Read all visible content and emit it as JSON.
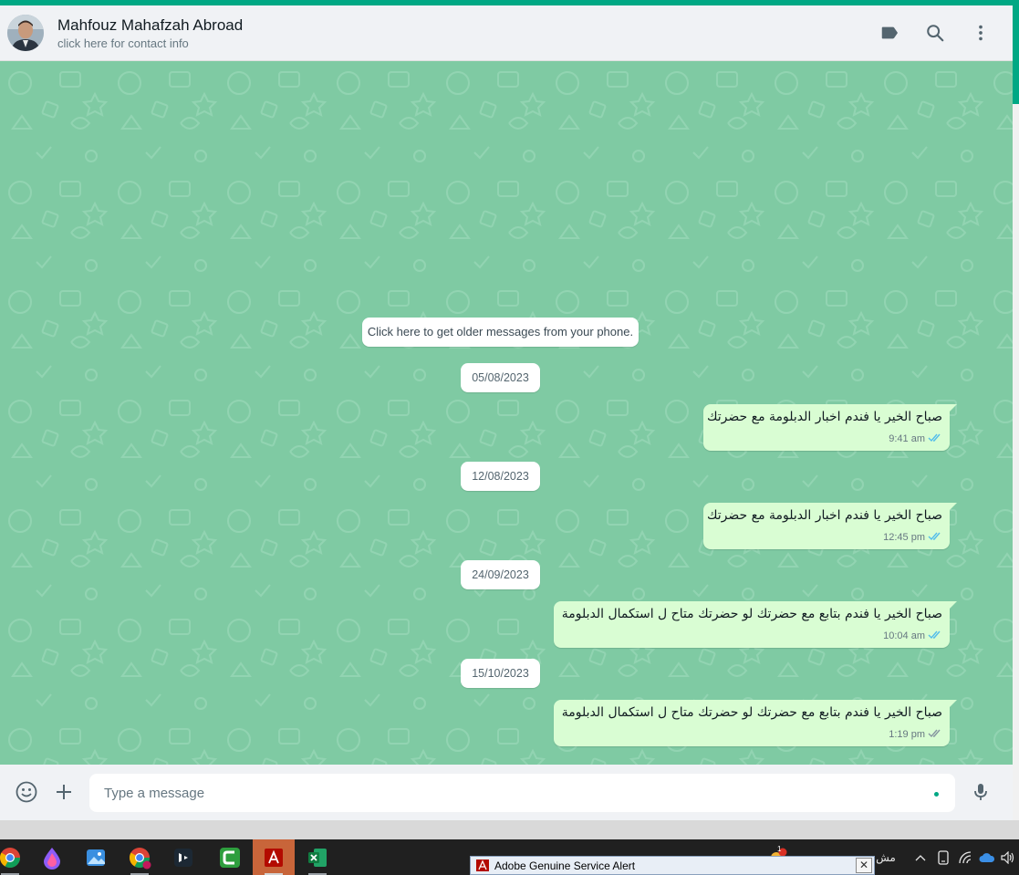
{
  "header": {
    "contact_name": "Mahfouz Mahafzah Abroad",
    "contact_subtitle": "click here for contact info",
    "icons": [
      "label-icon",
      "search-icon",
      "menu-icon"
    ]
  },
  "chat": {
    "older_messages_label": "Click here to get older messages from your phone.",
    "date_separators": [
      "05/08/2023",
      "12/08/2023",
      "24/09/2023",
      "15/10/2023"
    ],
    "messages": [
      {
        "text": "صباح الخير يا فندم اخبار الدبلومة مع حضرتك",
        "time": "9:41 am",
        "status": "read"
      },
      {
        "text": "صباح الخير يا فندم اخبار الدبلومة مع حضرتك",
        "time": "12:45 pm",
        "status": "read"
      },
      {
        "text": "صباح  الخير يا فندم بتابع مع حضرتك لو حضرتك متاح ل استكمال  الدبلومة",
        "time": "10:04 am",
        "status": "read"
      },
      {
        "text": "صباح  الخير يا فندم بتابع مع حضرتك لو حضرتك متاح ل استكمال  الدبلومة",
        "time": "1:19 pm",
        "status": "delivered"
      }
    ],
    "colors": {
      "wallpaper": "#7fcaa3",
      "outgoing_bubble": "#d9fdd3",
      "read_ticks": "#53bdeb",
      "delivered_ticks": "#8696a0",
      "accent": "#00a884"
    }
  },
  "composer": {
    "placeholder": "Type a message",
    "icons": [
      "emoji-icon",
      "attach-plus-icon",
      "microphone-icon"
    ]
  },
  "taskbar": {
    "apps": [
      "chrome-icon",
      "ink-drop-app-icon",
      "photos-icon",
      "chrome-profile-icon",
      "capcut-icon",
      "camtasia-icon",
      "adobe-acrobat-icon",
      "excel-icon"
    ],
    "adobe_alert_title": "Adobe Genuine Service Alert",
    "adobe_alert_close": "✕",
    "weather_badge": "1",
    "tray_partial_text": "مش"
  }
}
